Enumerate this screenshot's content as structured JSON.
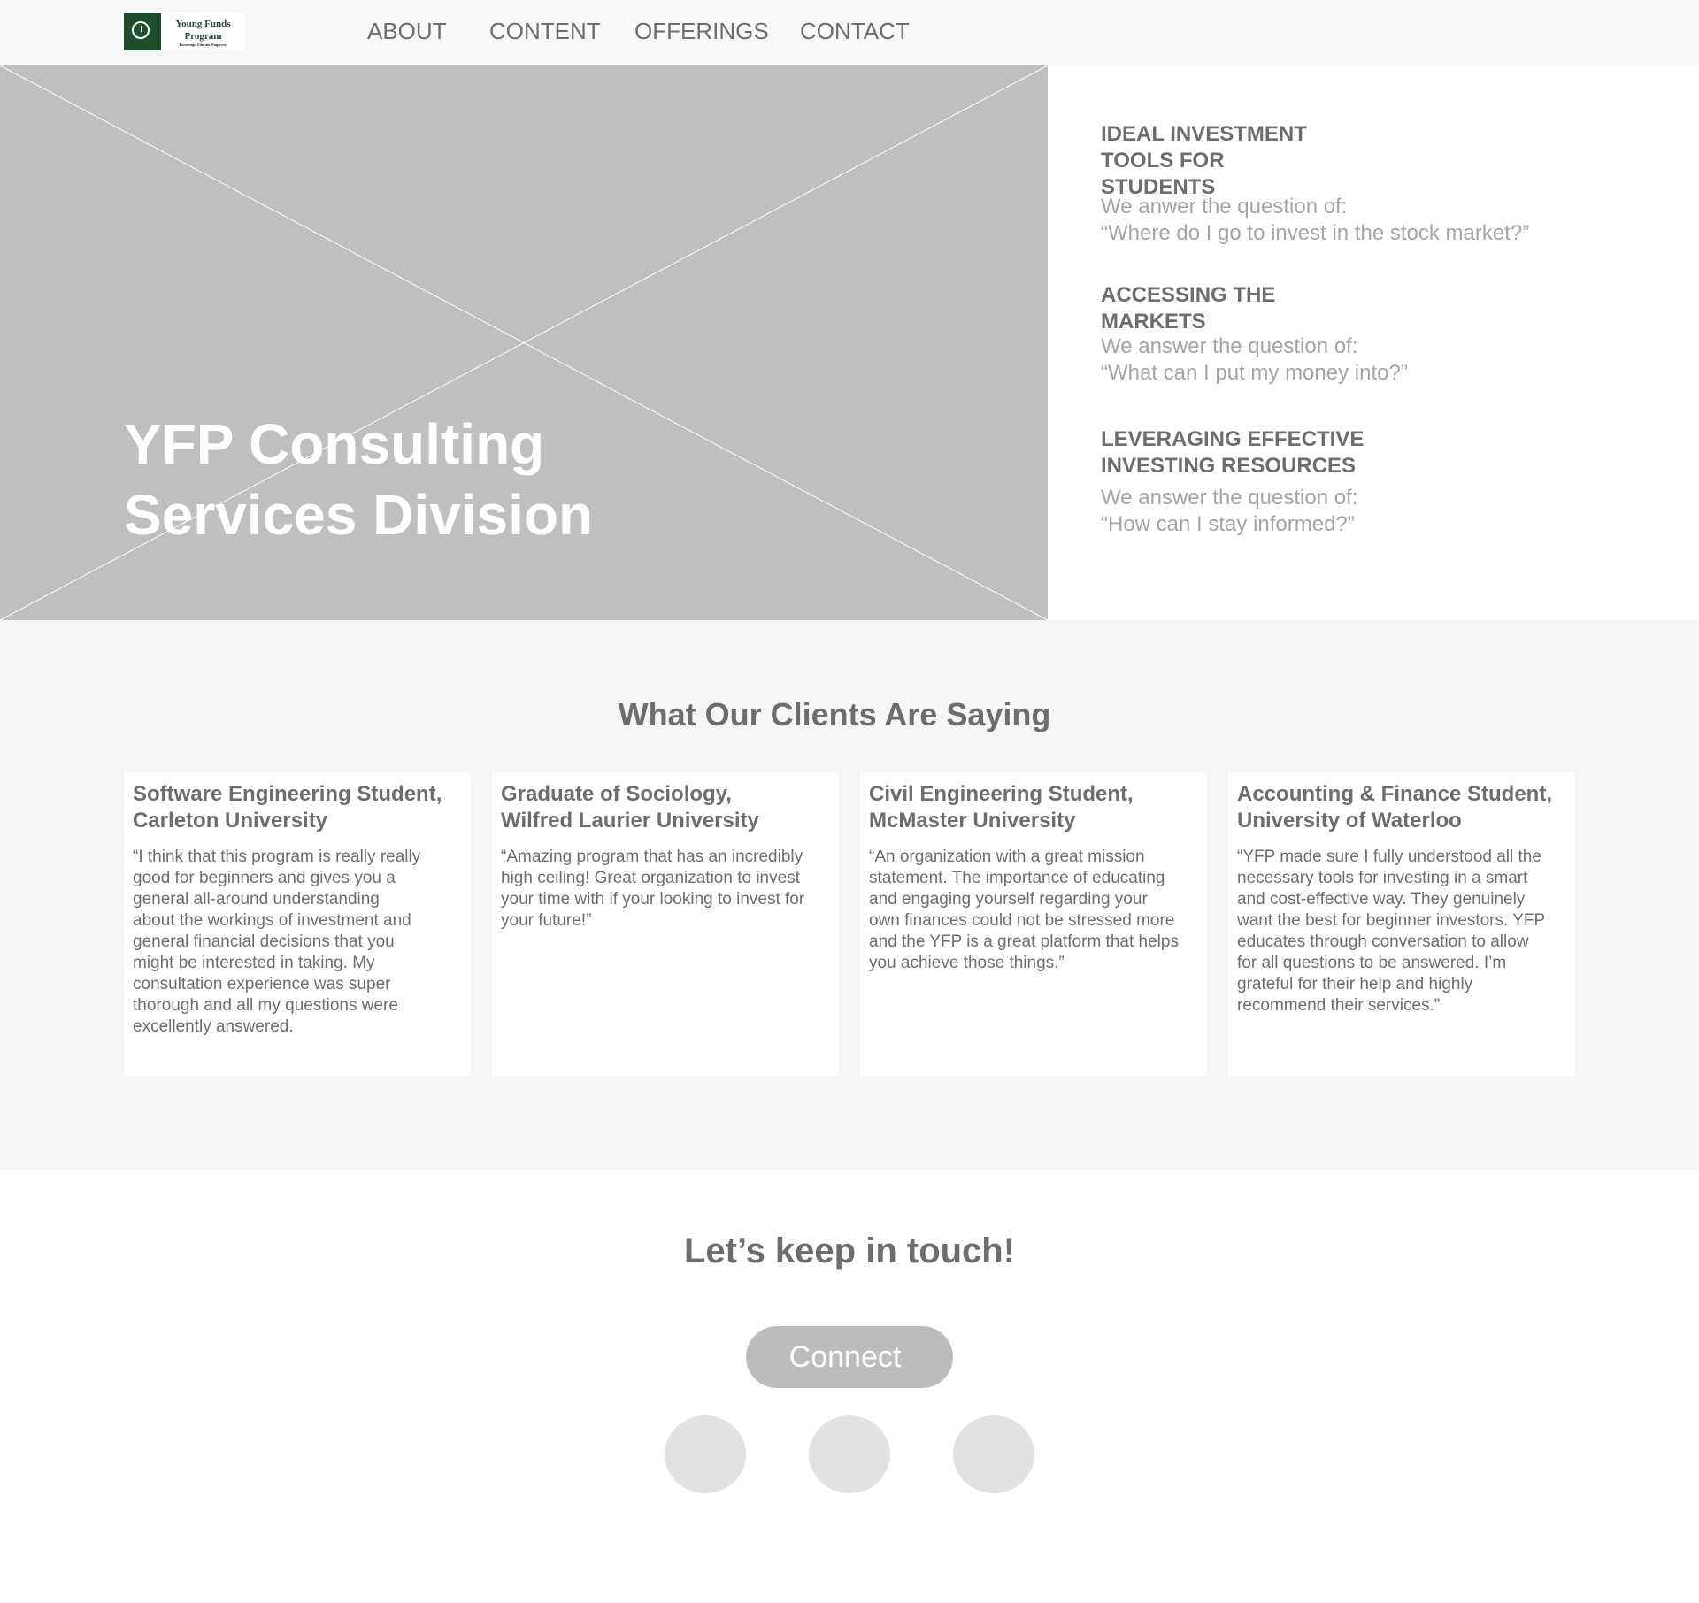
{
  "logo": {
    "name_line1": "Young Funds",
    "name_line2": "Program",
    "tagline": "Encourage. Educate. Empower."
  },
  "nav": {
    "items": [
      "ABOUT",
      "CONTENT",
      "OFFERINGS",
      "CONTACT"
    ]
  },
  "hero": {
    "title_line1": "YFP Consulting",
    "title_line2": "Services Division"
  },
  "info": [
    {
      "heading_lines": [
        "IDEAL INVESTMENT",
        "TOOLS FOR",
        "STUDENTS"
      ],
      "text_lines": [
        "We anwer the question of:",
        "“Where do I go to invest in the stock market?”"
      ]
    },
    {
      "heading_lines": [
        "ACCESSING THE",
        "MARKETS"
      ],
      "text_lines": [
        "We answer the question of:",
        "“What can I put my money into?”"
      ]
    },
    {
      "heading_lines": [
        "LEVERAGING EFFECTIVE",
        "INVESTING RESOURCES"
      ],
      "text_lines": [
        "We answer the question of:",
        "“How can I stay informed?”"
      ]
    }
  ],
  "testimonials": {
    "title": "What Our Clients Are Saying",
    "cards": [
      {
        "heading_lines": [
          "Software Engineering Student,",
          "Carleton University"
        ],
        "quote_lines": [
          "“I think that this program is really really",
          "good for beginners and gives you a",
          "general all-around understanding",
          "about the workings of investment and",
          "general financial decisions that you",
          "might be interested in taking. My",
          "consultation experience was super",
          "thorough and all my questions were",
          "excellently answered."
        ]
      },
      {
        "heading_lines": [
          "Graduate of Sociology,",
          "Wilfred Laurier University"
        ],
        "quote_lines": [
          "“Amazing program that has an incredibly",
          "high ceiling! Great organization to invest",
          "your time with if your looking to invest for",
          "your future!”"
        ]
      },
      {
        "heading_lines": [
          "Civil Engineering Student,",
          "McMaster University"
        ],
        "quote_lines": [
          "“An organization with a great mission",
          "statement. The importance of educating",
          "and engaging yourself regarding your",
          "own finances could not be stressed more",
          "and the YFP is a great platform that helps",
          "you achieve those things.”"
        ]
      },
      {
        "heading_lines": [
          "Accounting & Finance Student,",
          "University of Waterloo"
        ],
        "quote_lines": [
          "“YFP made sure I fully understood all the",
          "necessary tools for investing in a smart",
          "and cost-effective way. They genuinely",
          "want the best for beginner investors. YFP",
          "educates through conversation to allow",
          "for all questions to be answered. I’m",
          "grateful for their help and highly",
          "recommend their services.”"
        ]
      }
    ]
  },
  "cta": {
    "title": "Let’s keep in touch!",
    "button_label": "Connect"
  },
  "colors": {
    "header_bg": "#f8f8f8",
    "placeholder_bg": "#bebfc1",
    "section_bg": "#f6f6f6",
    "text": "#6d6d6d",
    "muted_text": "#a4a4a4",
    "logo_green": "#1f4e2e",
    "button_bg": "#bcbcbc",
    "social_circle": "#e2e2e2"
  }
}
